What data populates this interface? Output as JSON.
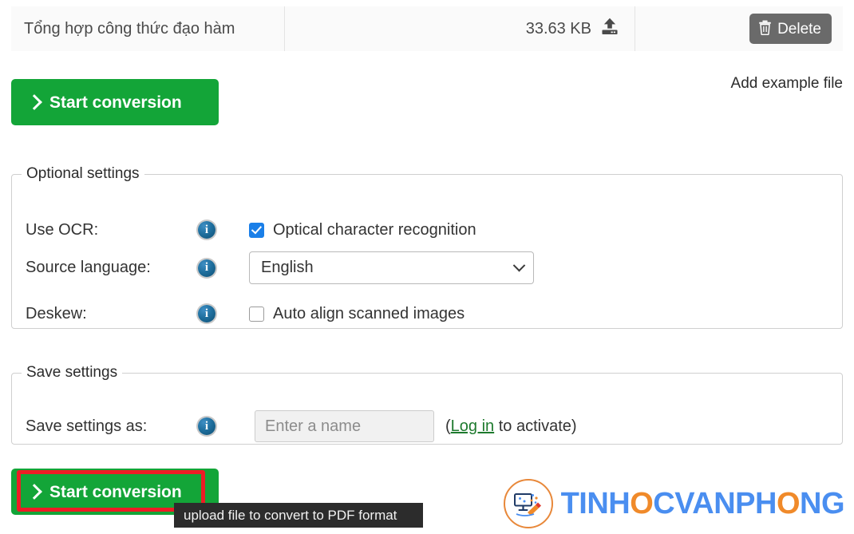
{
  "file_bar": {
    "file_name": "Tổng hợp công thức đạo hàm",
    "file_size": "33.63 KB",
    "upload_icon": "upload-icon",
    "delete_label": "Delete",
    "delete_icon": "trash-icon"
  },
  "actions": {
    "start_conversion_top": "Start conversion",
    "start_conversion_bottom": "Start conversion",
    "add_example_file": "Add example file",
    "chevron_icon": "chevron-right-icon"
  },
  "optional_settings": {
    "legend": "Optional settings",
    "info_icon": "info-icon",
    "rows": [
      {
        "label": "Use OCR:",
        "control": "checkbox",
        "control_label": "Optical character recognition",
        "checked": true
      },
      {
        "label": "Source language:",
        "control": "select",
        "selected_value": "English"
      },
      {
        "label": "Deskew:",
        "control": "checkbox",
        "control_label": "Auto align scanned images",
        "checked": false
      }
    ]
  },
  "save_settings": {
    "legend": "Save settings",
    "label": "Save settings as:",
    "info_icon": "info-icon",
    "input_placeholder": "Enter a name",
    "input_value": "",
    "note_prefix": "(",
    "note_link": "Log in",
    "note_suffix": " to activate)"
  },
  "tooltip": {
    "text": "upload file to convert to PDF format"
  },
  "annotation": {
    "type": "red-highlight-rectangle",
    "color": "#ee1c25"
  },
  "watermark": {
    "text_part_1": "TINH",
    "text_part_2": "O",
    "text_part_3": "CVANPH",
    "text_part_4": "O",
    "text_part_5": "NG",
    "full_text": "TINHOCVANPHONG",
    "logo_icon": "monitor-pencil-logo-icon"
  },
  "colors": {
    "primary_green": "#13a538",
    "delete_gray": "#6a6a6a",
    "checkbox_blue": "#1a7fe8",
    "link_green": "#1e7a2e",
    "annotation_red": "#ee1c25",
    "tooltip_bg": "#2c2c2c",
    "logo_blue": "#4a8ef0",
    "logo_orange": "#f08a2a"
  }
}
